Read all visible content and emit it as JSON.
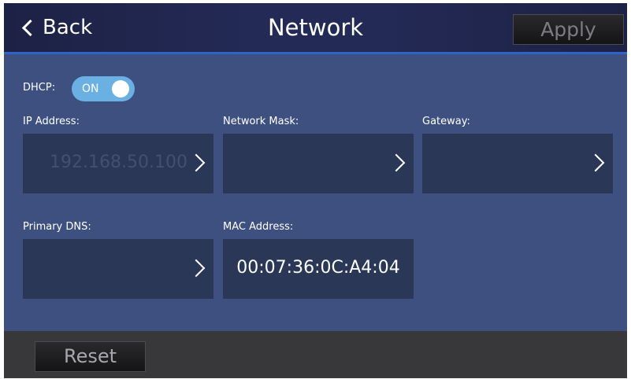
{
  "header": {
    "back_label": "Back",
    "title": "Network",
    "apply_label": "Apply",
    "back_icon": "chevron-left-icon"
  },
  "dhcp": {
    "label": "DHCP:",
    "state": "ON"
  },
  "fields": {
    "ip_address": {
      "label": "IP Address:",
      "value": "192.168.50.100"
    },
    "network_mask": {
      "label": "Network Mask:",
      "value": ""
    },
    "gateway": {
      "label": "Gateway:",
      "value": ""
    },
    "primary_dns": {
      "label": "Primary DNS:",
      "value": ""
    },
    "mac_address": {
      "label": "MAC Address:",
      "value": "00:07:36:0C:A4:04"
    }
  },
  "footer": {
    "reset_label": "Reset"
  },
  "colors": {
    "accent": "#2f63c9",
    "toggle_on": "#6ab0e3",
    "panel": "#3d5080",
    "field_bg": "#2a3757"
  }
}
